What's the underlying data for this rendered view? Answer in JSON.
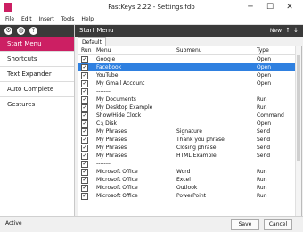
{
  "window": {
    "title": "FastKeys 2.22  -  Settings.fdb",
    "minimize": "─",
    "maximize": "☐",
    "close": "✕"
  },
  "menubar": [
    "File",
    "Edit",
    "Insert",
    "Tools",
    "Help"
  ],
  "sidebar": {
    "icons": [
      "gear-icon",
      "globe-icon",
      "help-icon"
    ],
    "items": [
      {
        "label": "Start Menu",
        "active": true
      },
      {
        "label": "Shortcuts",
        "active": false
      },
      {
        "label": "Text Expander",
        "active": false
      },
      {
        "label": "Auto Complete",
        "active": false
      },
      {
        "label": "Gestures",
        "active": false
      }
    ]
  },
  "main": {
    "title": "Start Menu",
    "new_label": "New",
    "up_label": "↑",
    "down_label": "↓",
    "tab": "Default",
    "columns": [
      "Run",
      "Menu",
      "Submenu",
      "Type"
    ],
    "rows": [
      {
        "checked": true,
        "menu": "Google",
        "submenu": "",
        "type": "Open",
        "selected": false
      },
      {
        "checked": true,
        "menu": "Facebook",
        "submenu": "",
        "type": "Open",
        "selected": true
      },
      {
        "checked": true,
        "menu": "YouTube",
        "submenu": "",
        "type": "Open",
        "selected": false
      },
      {
        "checked": true,
        "menu": "My Gmail Account",
        "submenu": "",
        "type": "Open",
        "selected": false
      },
      {
        "checked": true,
        "menu": "--------",
        "submenu": "",
        "type": "",
        "selected": false
      },
      {
        "checked": true,
        "menu": "My Documents",
        "submenu": "",
        "type": "Run",
        "selected": false
      },
      {
        "checked": true,
        "menu": "My Desktop Example",
        "submenu": "",
        "type": "Run",
        "selected": false
      },
      {
        "checked": true,
        "menu": "Show/Hide Clock",
        "submenu": "",
        "type": "Command",
        "selected": false
      },
      {
        "checked": true,
        "menu": "C:\\ Disk",
        "submenu": "",
        "type": "Open",
        "selected": false
      },
      {
        "checked": true,
        "menu": "My Phrases",
        "submenu": "Signature",
        "type": "Send",
        "selected": false
      },
      {
        "checked": true,
        "menu": "My Phrases",
        "submenu": "Thank you phrase",
        "type": "Send",
        "selected": false
      },
      {
        "checked": true,
        "menu": "My Phrases",
        "submenu": "Closing phrase",
        "type": "Send",
        "selected": false
      },
      {
        "checked": true,
        "menu": "My Phrases",
        "submenu": "HTML Example",
        "type": "Send",
        "selected": false
      },
      {
        "checked": true,
        "menu": "--------",
        "submenu": "",
        "type": "",
        "selected": false
      },
      {
        "checked": true,
        "menu": "Microsoft Office",
        "submenu": "Word",
        "type": "Run",
        "selected": false
      },
      {
        "checked": true,
        "menu": "Microsoft Office",
        "submenu": "Excel",
        "type": "Run",
        "selected": false
      },
      {
        "checked": true,
        "menu": "Microsoft Office",
        "submenu": "Outlook",
        "type": "Run",
        "selected": false
      },
      {
        "checked": true,
        "menu": "Microsoft Office",
        "submenu": "PowerPoint",
        "type": "Run",
        "selected": false
      }
    ]
  },
  "statusbar": {
    "status": "Active",
    "save_label": "Save",
    "cancel_label": "Cancel"
  },
  "colors": {
    "accent": "#cc1f63",
    "selection": "#2f80e0",
    "header": "#3a3a3a"
  }
}
